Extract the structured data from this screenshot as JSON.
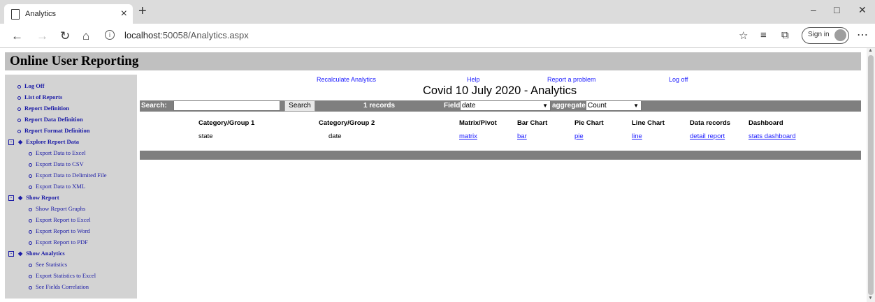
{
  "browser": {
    "tab_title": "Analytics",
    "url_host": "localhost",
    "url_path": ":50058/Analytics.aspx",
    "signin_label": "Sign in"
  },
  "page_title": "Online User Reporting",
  "sidebar": {
    "items": [
      {
        "label": "Log Off"
      },
      {
        "label": "List of Reports"
      },
      {
        "label": "Report Definition"
      },
      {
        "label": "Report Data Definition"
      },
      {
        "label": "Report Format Definition"
      },
      {
        "label": "Explore Report Data"
      },
      {
        "label": "Export Data to Excel"
      },
      {
        "label": "Export Data to CSV"
      },
      {
        "label": "Export Data to Delimited File"
      },
      {
        "label": "Export Data to XML"
      },
      {
        "label": "Show Report"
      },
      {
        "label": "Show Report Graphs"
      },
      {
        "label": "Export Report to Excel"
      },
      {
        "label": "Export Report to Word"
      },
      {
        "label": "Export Report to PDF"
      },
      {
        "label": "Show Analytics"
      },
      {
        "label": "See Statistics"
      },
      {
        "label": "Export Statistics to Excel"
      },
      {
        "label": "See Fields Correlation"
      }
    ]
  },
  "toplinks": {
    "recalculate": "Recalculate Analytics",
    "help": "Help",
    "report_problem": "Report a problem",
    "logoff": "Log off"
  },
  "main_title": "Covid 10 July 2020 - Analytics",
  "searchbar": {
    "search_label": "Search:",
    "search_value": "",
    "search_button": "Search",
    "records": "1 records",
    "field_label": "Field",
    "field_value": "date",
    "aggregate_label": "aggregate",
    "aggregate_value": "Count"
  },
  "table": {
    "headers": [
      "Category/Group 1",
      "Category/Group 2",
      "Matrix/Pivot",
      "Bar Chart",
      "Pie Chart",
      "Line Chart",
      "Data records",
      "Dashboard"
    ],
    "row": {
      "group1": "state",
      "group2": "date",
      "matrix": "matrix",
      "bar": "bar",
      "pie": "pie",
      "line": "line",
      "detail": "detail report",
      "dashboard": "stats dashboard"
    }
  }
}
